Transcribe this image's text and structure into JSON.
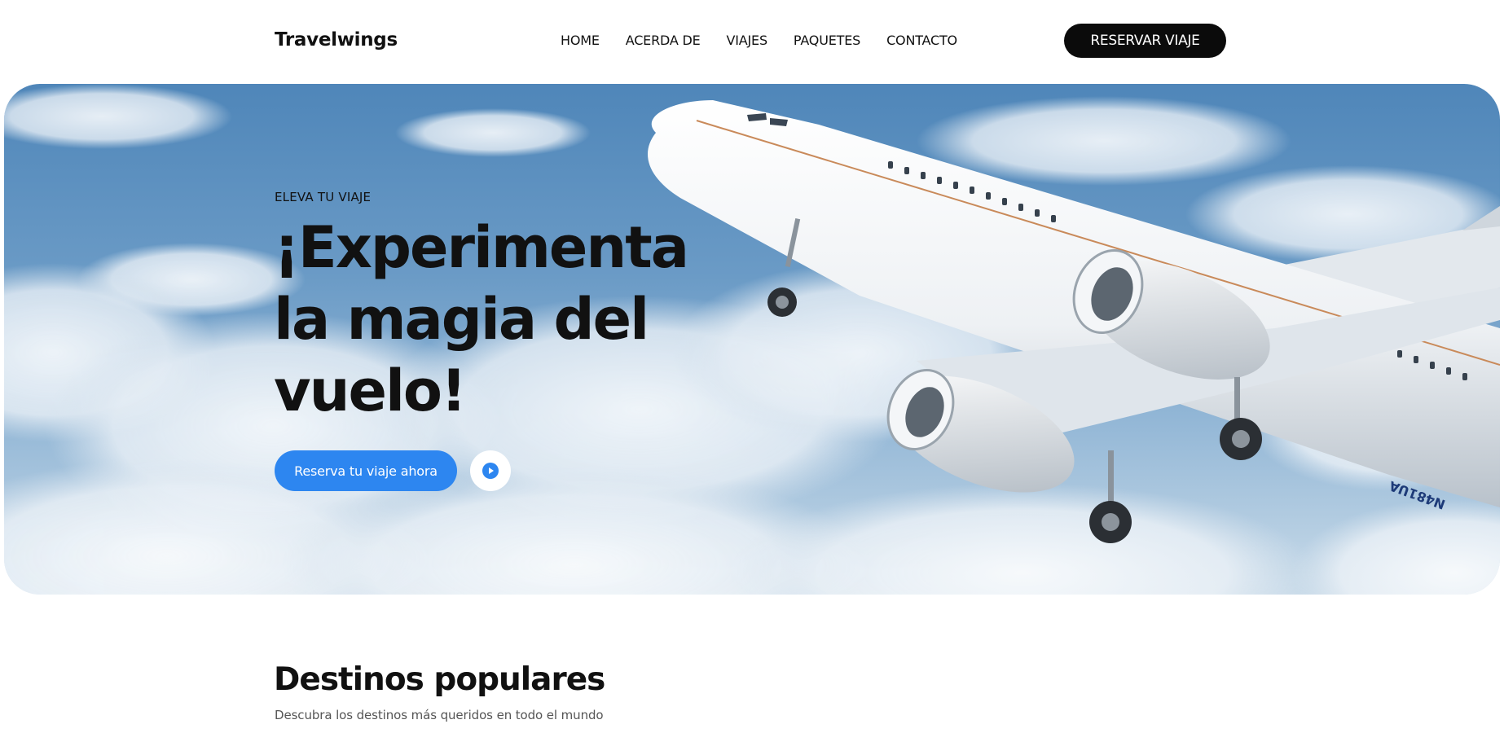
{
  "header": {
    "brand": "Travelwings",
    "nav": [
      "HOME",
      "ACERDA DE",
      "VIAJES",
      "PAQUETES",
      "CONTACTO"
    ],
    "cta_label": "RESERVAR VIAJE"
  },
  "hero": {
    "eyebrow": "ELEVA TU VIAJE",
    "headline": "¡Experimenta la magia del vuelo!",
    "primary_button": "Reserva tu viaje ahora",
    "play_icon": "play-circle-icon",
    "airplane_registration": "N481UA"
  },
  "destinations": {
    "title": "Destinos populares",
    "subtitle": "Descubra los destinos más queridos en todo el mundo"
  },
  "colors": {
    "primary": "#2d86f0",
    "dark": "#0b0b0b",
    "sky": "#5b8fc0"
  }
}
